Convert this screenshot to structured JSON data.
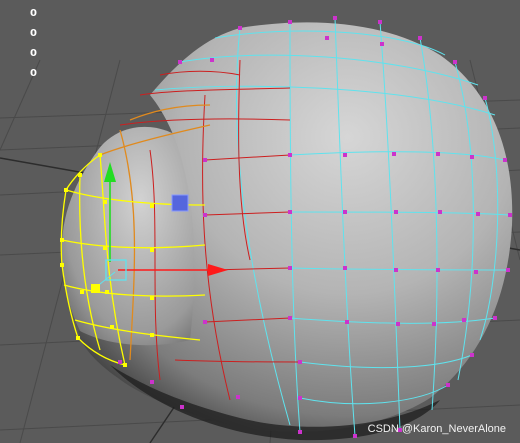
{
  "viewport": {
    "hud_values": [
      "0",
      "0",
      "0",
      "0"
    ],
    "selection_color": "#ffff00",
    "wire_color": "#5fe3ee",
    "vertex_color": "#cc33cc",
    "soft_select_color": "#e08a1e",
    "edge_falloff_color": "#cc1f1f",
    "manipulator": {
      "x_axis_color": "#ff1a1a",
      "y_axis_color": "#22dd22",
      "z_handle_color": "#5566dd"
    }
  },
  "watermark": "CSDN @Karon_NeverAlone"
}
